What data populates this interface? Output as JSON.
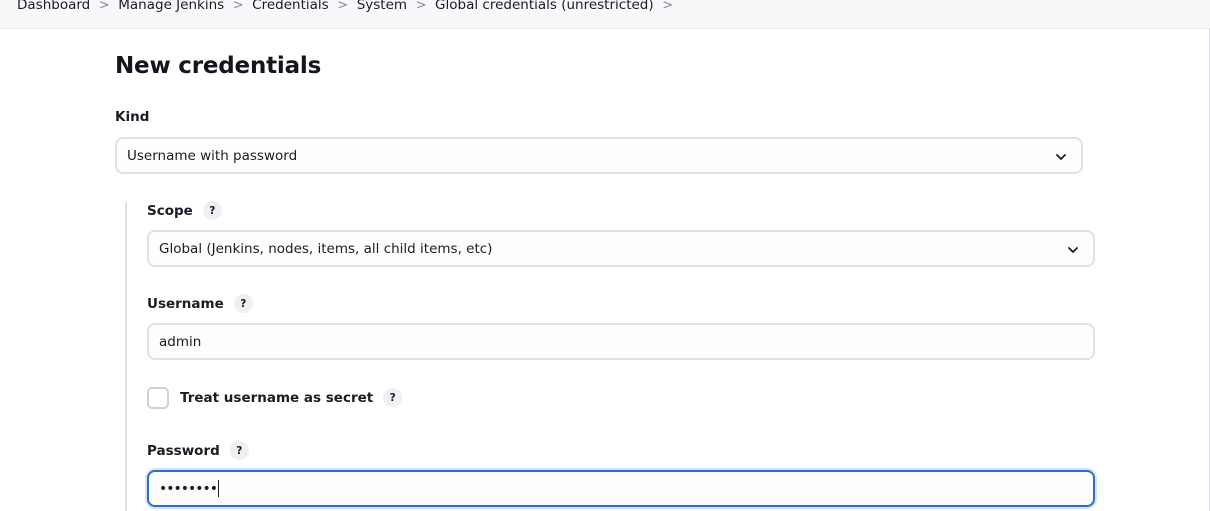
{
  "breadcrumb": {
    "items": [
      "Dashboard",
      "Manage Jenkins",
      "Credentials",
      "System",
      "Global credentials (unrestricted)"
    ],
    "separator": ">"
  },
  "page": {
    "title": "New credentials"
  },
  "form": {
    "kind": {
      "label": "Kind",
      "value": "Username with password"
    },
    "scope": {
      "label": "Scope",
      "help": "?",
      "value": "Global (Jenkins, nodes, items, all child items, etc)"
    },
    "username": {
      "label": "Username",
      "help": "?",
      "value": "admin"
    },
    "treat_secret": {
      "label": "Treat username as secret",
      "help": "?",
      "checked": false
    },
    "password": {
      "label": "Password",
      "help": "?",
      "value": "••••••••",
      "focused": true
    }
  },
  "colors": {
    "focus_border": "#2f6fbf",
    "field_border": "#e0e1e6",
    "help_bg": "#eef0f3"
  }
}
